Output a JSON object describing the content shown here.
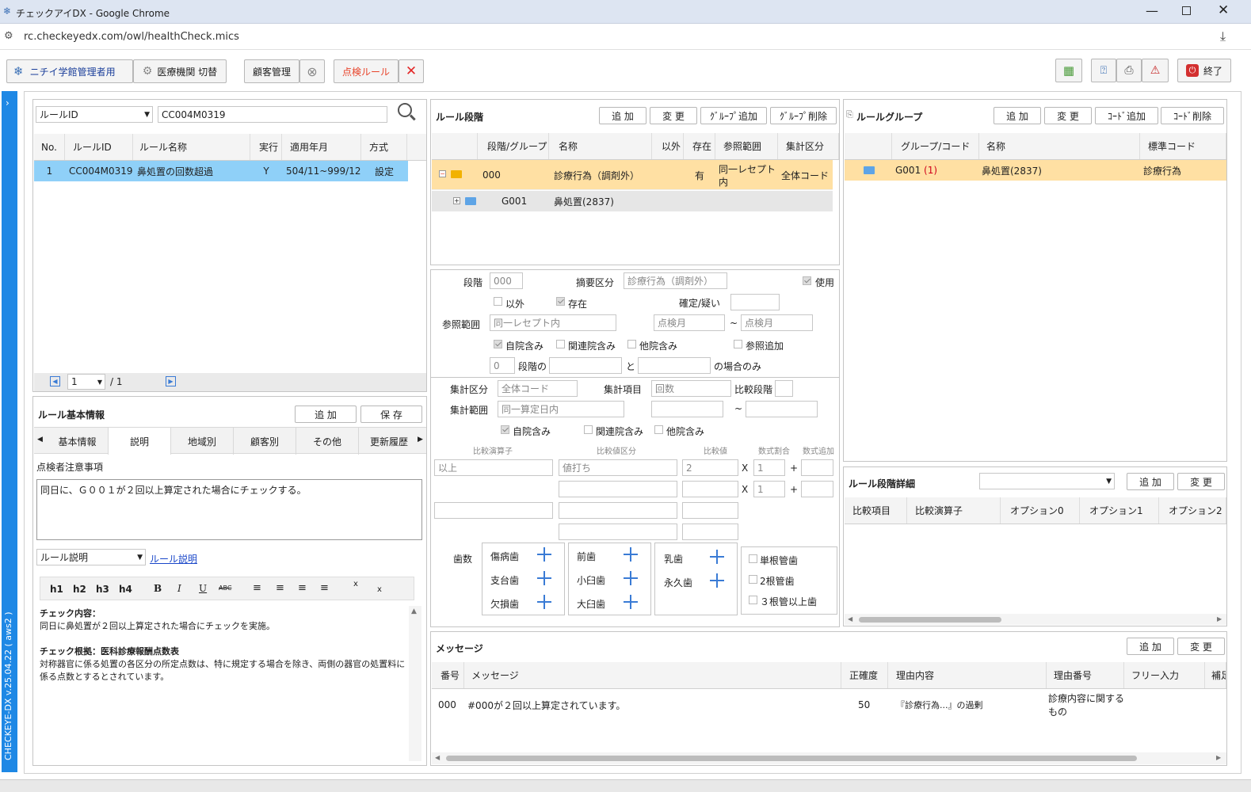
{
  "window": {
    "title": "チェックアイDX - Google Chrome",
    "url": "rc.checkeyedx.com/owl/healthCheck.mics"
  },
  "toolbar": {
    "user": "ニチイ学館管理者用",
    "switch": "医療機関 切替",
    "customer": "顧客管理",
    "rule": "点検ルール",
    "exit": "終了"
  },
  "side": {
    "version": "CHECKEYE-DX v.25.04.22 ( aws2 )"
  },
  "left": {
    "search_field": "ルールID",
    "search_value": "CC004M0319",
    "headers": [
      "No.",
      "ルールID",
      "ルール名称",
      "実行",
      "適用年月",
      "方式"
    ],
    "rows": [
      {
        "no": "1",
        "id": "CC004M0319",
        "name": "鼻処置の回数超過",
        "exec": "Y",
        "period": "504/11~999/12",
        "method": "設定"
      }
    ],
    "page": "1",
    "page_total": "/ 1",
    "basic_title": "ルール基本情報",
    "add": "追 加",
    "save": "保 存",
    "tabs": [
      "基本情報",
      "説明",
      "地域別",
      "顧客別",
      "その他",
      "更新履歴"
    ],
    "notes_label": "点検者注意事項",
    "notes_text": "同日に、Ｇ００１が２回以上算定された場合にチェックする。",
    "desc_select": "ルール説明",
    "desc_link": "ルール説明",
    "editor": [
      "h1",
      "h2",
      "h3",
      "h4",
      "B",
      "I",
      "U",
      "ABC"
    ],
    "content_title1": "チェック内容：",
    "content_text1": "同日に鼻処置が２回以上算定された場合にチェックを実施。",
    "content_title2": "チェック根拠：医科診療報酬点数表",
    "content_text2": "対称器官に係る処置の各区分の所定点数は、特に規定する場合を除き、両側の器官の処置料に係る点数とするとされています。"
  },
  "stage": {
    "title": "ルール段階",
    "add": "追 加",
    "change": "変 更",
    "group_add": "ｸﾞﾙｰﾌﾟ追加",
    "group_del": "ｸﾞﾙｰﾌﾟ削除",
    "headers": [
      "段階/グループ",
      "名称",
      "以外",
      "存在",
      "参照範囲",
      "集計区分"
    ],
    "row1": {
      "code": "000",
      "name": "診療行為（調剤外）",
      "exists": "有",
      "range": "同一レセプト内",
      "agg": "全体コード"
    },
    "row2": {
      "code": "G001",
      "name": "鼻処置(2837)"
    }
  },
  "form": {
    "stage_lbl": "段階",
    "stage_val": "000",
    "summary_lbl": "摘要区分",
    "summary_val": "診療行為（調剤外）",
    "use": "使用",
    "other": "以外",
    "exist": "存在",
    "confirm": "確定/疑い",
    "ref_lbl": "参照範囲",
    "ref_val": "同一レセプト内",
    "month1": "点検月",
    "tilde": "~",
    "month2": "点検月",
    "self": "自院含み",
    "related": "関連院含み",
    "others": "他院含み",
    "refadd": "参照追加",
    "stage_num": "0",
    "stage_of": "段階の",
    "and": "と",
    "only": "の場合のみ",
    "agg_lbl": "集計区分",
    "agg_val": "全体コード",
    "item_lbl": "集計項目",
    "item_val": "回数",
    "cmp_lbl": "比較段階",
    "range_lbl": "集計範囲",
    "range_val": "同一算定日内",
    "op_h": "比較演算子",
    "kind_h": "比較値区分",
    "val_h": "比較値",
    "ratio_h": "数式割合",
    "addh": "数式追加",
    "op": "以上",
    "kind": "値打ち",
    "val": "2",
    "x": "X",
    "ratio1": "1",
    "plus": "+",
    "ratio2": "1",
    "teeth_lbl": "歯数",
    "teeth": [
      "傷病歯",
      "支台歯",
      "欠損歯",
      "前歯",
      "小臼歯",
      "大臼歯",
      "乳歯",
      "永久歯"
    ],
    "canal": [
      "単根管歯",
      "2根管歯",
      "３根管以上歯"
    ]
  },
  "group": {
    "title": "ルールグループ",
    "add": "追 加",
    "change": "変 更",
    "code_add": "ｺｰﾄﾞ追加",
    "code_del": "ｺｰﾄﾞ削除",
    "headers": [
      "グループ/コード",
      "名称",
      "標準コード"
    ],
    "row": {
      "code": "G001",
      "count": "(1)",
      "name": "鼻処置(2837)",
      "std": "診療行為"
    }
  },
  "detail": {
    "title": "ルール段階詳細",
    "add": "追 加",
    "change": "変 更",
    "headers": [
      "比較項目",
      "比較演算子",
      "オプション0",
      "オプション1",
      "オプション2"
    ]
  },
  "message": {
    "title": "メッセージ",
    "add": "追 加",
    "change": "変 更",
    "headers": [
      "番号",
      "メッセージ",
      "正確度",
      "理由内容",
      "理由番号",
      "フリー入力",
      "補足"
    ],
    "row": {
      "no": "000",
      "msg": "#000が２回以上算定されています。",
      "acc": "50",
      "reason": "『診療行為...』の過剰",
      "reason_no": "診療内容に関するもの"
    }
  },
  "colors": {
    "accent": "#1e88e5",
    "selected": "#8fd0f8",
    "orange": "#ffe0a3"
  }
}
